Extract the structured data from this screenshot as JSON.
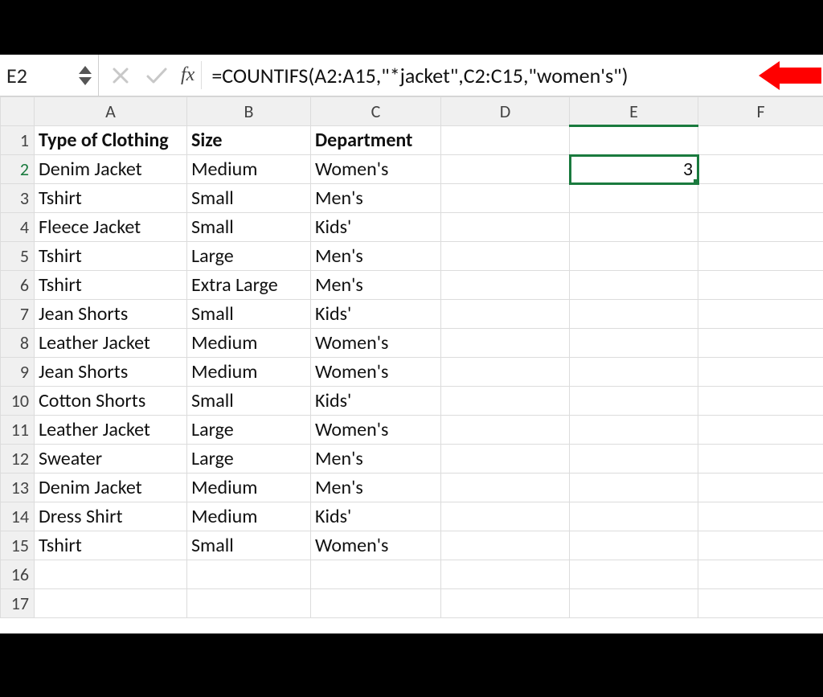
{
  "namebox": "E2",
  "formula": "=COUNTIFS(A2:A15,\"*jacket\",C2:C15,\"women's\")",
  "columns": [
    "A",
    "B",
    "C",
    "D",
    "E",
    "F"
  ],
  "rows": [
    "1",
    "2",
    "3",
    "4",
    "5",
    "6",
    "7",
    "8",
    "9",
    "10",
    "11",
    "12",
    "13",
    "14",
    "15",
    "16",
    "17"
  ],
  "headers": {
    "A": "Type of Clothing",
    "B": "Size",
    "C": "Department"
  },
  "data": [
    {
      "A": "Denim Jacket",
      "B": "Medium",
      "C": "Women's"
    },
    {
      "A": "Tshirt",
      "B": "Small",
      "C": "Men's"
    },
    {
      "A": "Fleece Jacket",
      "B": "Small",
      "C": "Kids'"
    },
    {
      "A": "Tshirt",
      "B": "Large",
      "C": "Men's"
    },
    {
      "A": "Tshirt",
      "B": "Extra Large",
      "C": "Men's"
    },
    {
      "A": "Jean Shorts",
      "B": "Small",
      "C": "Kids'"
    },
    {
      "A": "Leather Jacket",
      "B": "Medium",
      "C": "Women's"
    },
    {
      "A": "Jean Shorts",
      "B": "Medium",
      "C": "Women's"
    },
    {
      "A": "Cotton Shorts",
      "B": "Small",
      "C": "Kids'"
    },
    {
      "A": "Leather Jacket",
      "B": "Large",
      "C": "Women's"
    },
    {
      "A": "Sweater",
      "B": "Large",
      "C": "Men's"
    },
    {
      "A": "Denim Jacket",
      "B": "Medium",
      "C": "Men's"
    },
    {
      "A": "Dress Shirt",
      "B": "Medium",
      "C": "Kids'"
    },
    {
      "A": "Tshirt",
      "B": "Small",
      "C": "Women's"
    }
  ],
  "resultCell": {
    "ref": "E2",
    "value": "3"
  },
  "selected": {
    "col": "E",
    "row": "2"
  },
  "colors": {
    "arrow": "#ff0000",
    "selection": "#1a7a3e"
  }
}
